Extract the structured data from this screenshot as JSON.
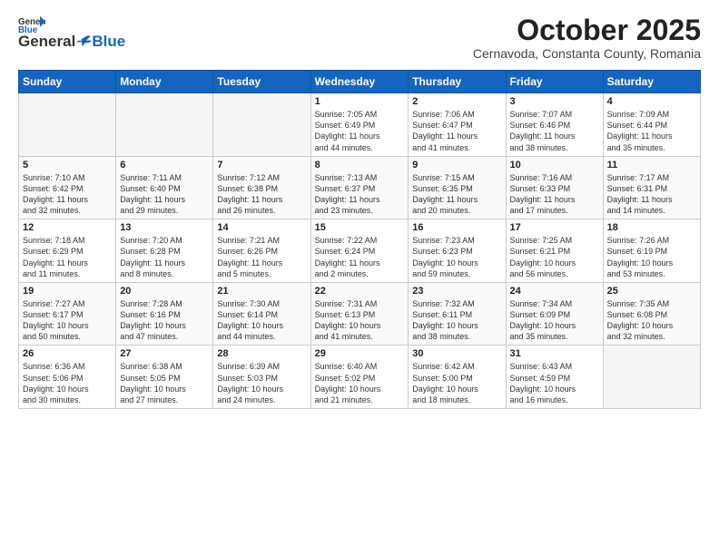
{
  "logo": {
    "general": "General",
    "blue": "Blue"
  },
  "title": "October 2025",
  "location": "Cernavoda, Constanta County, Romania",
  "weekdays": [
    "Sunday",
    "Monday",
    "Tuesday",
    "Wednesday",
    "Thursday",
    "Friday",
    "Saturday"
  ],
  "weeks": [
    [
      {
        "day": "",
        "info": ""
      },
      {
        "day": "",
        "info": ""
      },
      {
        "day": "",
        "info": ""
      },
      {
        "day": "1",
        "info": "Sunrise: 7:05 AM\nSunset: 6:49 PM\nDaylight: 11 hours\nand 44 minutes."
      },
      {
        "day": "2",
        "info": "Sunrise: 7:06 AM\nSunset: 6:47 PM\nDaylight: 11 hours\nand 41 minutes."
      },
      {
        "day": "3",
        "info": "Sunrise: 7:07 AM\nSunset: 6:46 PM\nDaylight: 11 hours\nand 38 minutes."
      },
      {
        "day": "4",
        "info": "Sunrise: 7:09 AM\nSunset: 6:44 PM\nDaylight: 11 hours\nand 35 minutes."
      }
    ],
    [
      {
        "day": "5",
        "info": "Sunrise: 7:10 AM\nSunset: 6:42 PM\nDaylight: 11 hours\nand 32 minutes."
      },
      {
        "day": "6",
        "info": "Sunrise: 7:11 AM\nSunset: 6:40 PM\nDaylight: 11 hours\nand 29 minutes."
      },
      {
        "day": "7",
        "info": "Sunrise: 7:12 AM\nSunset: 6:38 PM\nDaylight: 11 hours\nand 26 minutes."
      },
      {
        "day": "8",
        "info": "Sunrise: 7:13 AM\nSunset: 6:37 PM\nDaylight: 11 hours\nand 23 minutes."
      },
      {
        "day": "9",
        "info": "Sunrise: 7:15 AM\nSunset: 6:35 PM\nDaylight: 11 hours\nand 20 minutes."
      },
      {
        "day": "10",
        "info": "Sunrise: 7:16 AM\nSunset: 6:33 PM\nDaylight: 11 hours\nand 17 minutes."
      },
      {
        "day": "11",
        "info": "Sunrise: 7:17 AM\nSunset: 6:31 PM\nDaylight: 11 hours\nand 14 minutes."
      }
    ],
    [
      {
        "day": "12",
        "info": "Sunrise: 7:18 AM\nSunset: 6:29 PM\nDaylight: 11 hours\nand 11 minutes."
      },
      {
        "day": "13",
        "info": "Sunrise: 7:20 AM\nSunset: 6:28 PM\nDaylight: 11 hours\nand 8 minutes."
      },
      {
        "day": "14",
        "info": "Sunrise: 7:21 AM\nSunset: 6:26 PM\nDaylight: 11 hours\nand 5 minutes."
      },
      {
        "day": "15",
        "info": "Sunrise: 7:22 AM\nSunset: 6:24 PM\nDaylight: 11 hours\nand 2 minutes."
      },
      {
        "day": "16",
        "info": "Sunrise: 7:23 AM\nSunset: 6:23 PM\nDaylight: 10 hours\nand 59 minutes."
      },
      {
        "day": "17",
        "info": "Sunrise: 7:25 AM\nSunset: 6:21 PM\nDaylight: 10 hours\nand 56 minutes."
      },
      {
        "day": "18",
        "info": "Sunrise: 7:26 AM\nSunset: 6:19 PM\nDaylight: 10 hours\nand 53 minutes."
      }
    ],
    [
      {
        "day": "19",
        "info": "Sunrise: 7:27 AM\nSunset: 6:17 PM\nDaylight: 10 hours\nand 50 minutes."
      },
      {
        "day": "20",
        "info": "Sunrise: 7:28 AM\nSunset: 6:16 PM\nDaylight: 10 hours\nand 47 minutes."
      },
      {
        "day": "21",
        "info": "Sunrise: 7:30 AM\nSunset: 6:14 PM\nDaylight: 10 hours\nand 44 minutes."
      },
      {
        "day": "22",
        "info": "Sunrise: 7:31 AM\nSunset: 6:13 PM\nDaylight: 10 hours\nand 41 minutes."
      },
      {
        "day": "23",
        "info": "Sunrise: 7:32 AM\nSunset: 6:11 PM\nDaylight: 10 hours\nand 38 minutes."
      },
      {
        "day": "24",
        "info": "Sunrise: 7:34 AM\nSunset: 6:09 PM\nDaylight: 10 hours\nand 35 minutes."
      },
      {
        "day": "25",
        "info": "Sunrise: 7:35 AM\nSunset: 6:08 PM\nDaylight: 10 hours\nand 32 minutes."
      }
    ],
    [
      {
        "day": "26",
        "info": "Sunrise: 6:36 AM\nSunset: 5:06 PM\nDaylight: 10 hours\nand 30 minutes."
      },
      {
        "day": "27",
        "info": "Sunrise: 6:38 AM\nSunset: 5:05 PM\nDaylight: 10 hours\nand 27 minutes."
      },
      {
        "day": "28",
        "info": "Sunrise: 6:39 AM\nSunset: 5:03 PM\nDaylight: 10 hours\nand 24 minutes."
      },
      {
        "day": "29",
        "info": "Sunrise: 6:40 AM\nSunset: 5:02 PM\nDaylight: 10 hours\nand 21 minutes."
      },
      {
        "day": "30",
        "info": "Sunrise: 6:42 AM\nSunset: 5:00 PM\nDaylight: 10 hours\nand 18 minutes."
      },
      {
        "day": "31",
        "info": "Sunrise: 6:43 AM\nSunset: 4:59 PM\nDaylight: 10 hours\nand 16 minutes."
      },
      {
        "day": "",
        "info": ""
      }
    ]
  ]
}
